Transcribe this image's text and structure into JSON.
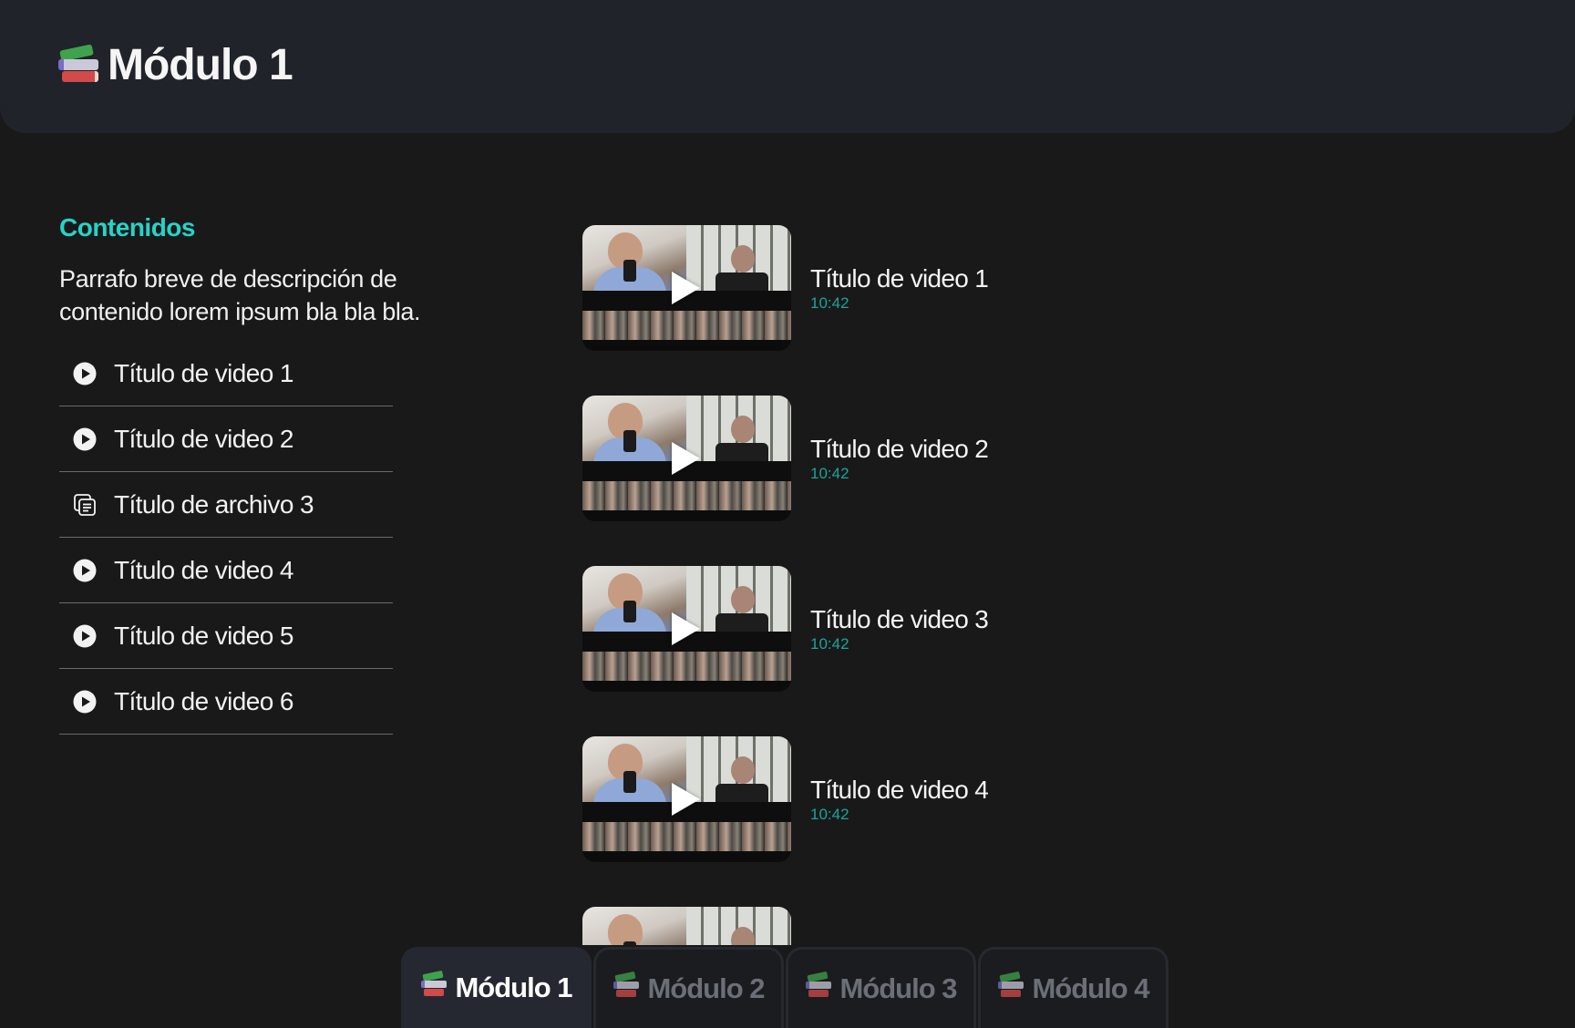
{
  "header": {
    "title": "Módulo 1",
    "icon": "books-icon"
  },
  "contents": {
    "heading": "Contenidos",
    "description": "Parrafo breve de descripción de contenido lorem ipsum bla bla bla.",
    "items": [
      {
        "label": "Título de video 1",
        "icon": "play-circle-icon"
      },
      {
        "label": "Título de video 2",
        "icon": "play-circle-icon"
      },
      {
        "label": "Título de archivo 3",
        "icon": "document-icon"
      },
      {
        "label": "Título de video 4",
        "icon": "play-circle-icon"
      },
      {
        "label": "Título de video 5",
        "icon": "play-circle-icon"
      },
      {
        "label": "Título de video 6",
        "icon": "play-circle-icon"
      }
    ]
  },
  "videos": [
    {
      "title": "Título de video 1",
      "duration": "10:42"
    },
    {
      "title": "Título de video 2",
      "duration": "10:42"
    },
    {
      "title": "Título de video 3",
      "duration": "10:42"
    },
    {
      "title": "Título de video 4",
      "duration": "10:42"
    },
    {
      "title": "",
      "duration": ""
    }
  ],
  "tabs": [
    {
      "label": "Módulo 1",
      "active": true
    },
    {
      "label": "Módulo 2",
      "active": false
    },
    {
      "label": "Módulo 3",
      "active": false
    },
    {
      "label": "Módulo 4",
      "active": false
    }
  ],
  "colors": {
    "background": "#19191a",
    "header": "#20232a",
    "accent": "#27d3c8",
    "duration": "#1aa49a",
    "tab_active": "#252830",
    "tab_inactive_text": "#6a6f78"
  }
}
